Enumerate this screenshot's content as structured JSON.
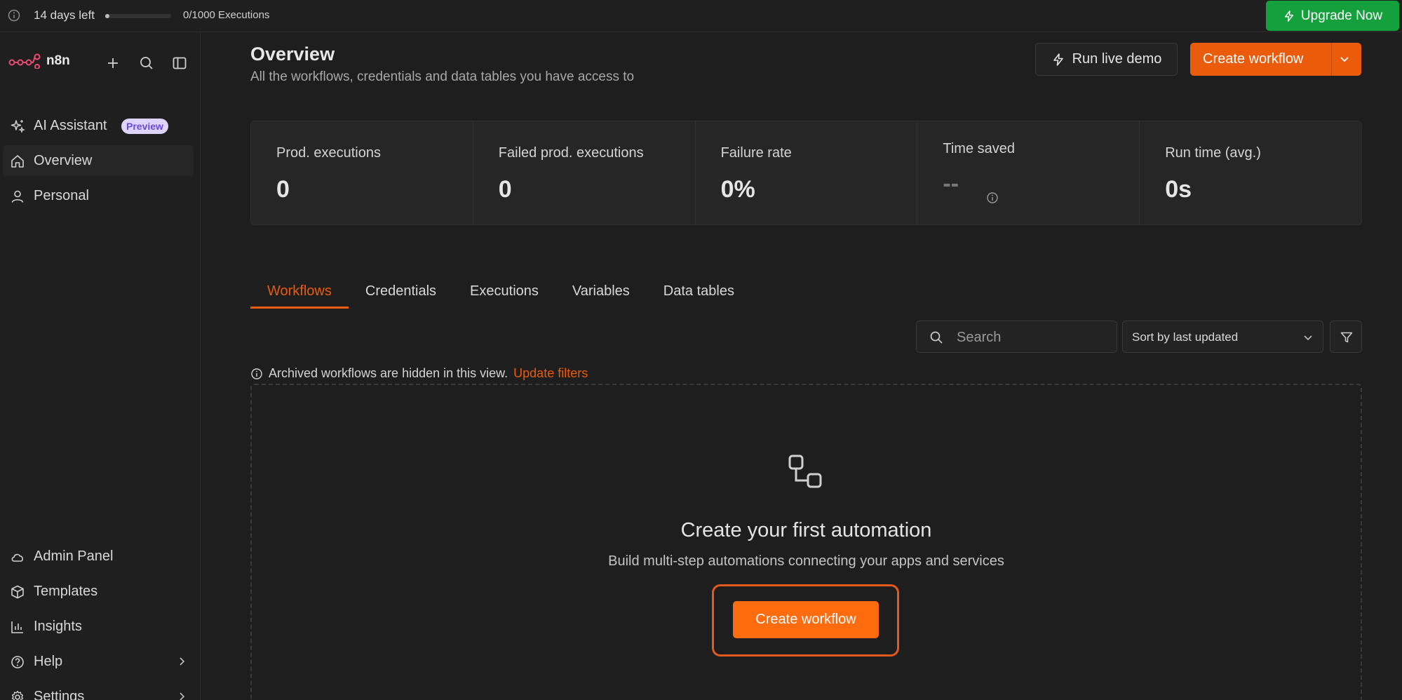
{
  "topbar": {
    "days_left": "14 days left",
    "executions": "0/1000 Executions",
    "upgrade_label": "Upgrade Now"
  },
  "sidebar": {
    "logo_text": "n8n",
    "top_items": [
      {
        "label": "AI Assistant",
        "badge": "Preview",
        "icon": "sparkles-icon"
      },
      {
        "label": "Overview",
        "icon": "home-icon"
      },
      {
        "label": "Personal",
        "icon": "user-icon"
      }
    ],
    "bottom_items": [
      {
        "label": "Admin Panel",
        "icon": "cloud-icon"
      },
      {
        "label": "Templates",
        "icon": "box-icon"
      },
      {
        "label": "Insights",
        "icon": "bar-chart-icon"
      },
      {
        "label": "Help",
        "icon": "help-circle-icon"
      },
      {
        "label": "Settings",
        "icon": "gear-icon"
      }
    ]
  },
  "header": {
    "title": "Overview",
    "subtitle": "All the workflows, credentials and data tables you have access to",
    "run_demo_label": "Run live demo",
    "create_workflow_label": "Create workflow"
  },
  "stats": [
    {
      "label": "Prod. executions",
      "value": "0"
    },
    {
      "label": "Failed prod. executions",
      "value": "0"
    },
    {
      "label": "Failure rate",
      "value": "0%"
    },
    {
      "label": "Time saved",
      "value": "--"
    },
    {
      "label": "Run time (avg.)",
      "value": "0s"
    }
  ],
  "tabs": [
    "Workflows",
    "Credentials",
    "Executions",
    "Variables",
    "Data tables"
  ],
  "toolbar": {
    "search_placeholder": "Search",
    "sort_value": "Sort by last updated"
  },
  "notice": {
    "text": "Archived workflows are hidden in this view.",
    "link": "Update filters"
  },
  "empty_state": {
    "title": "Create your first automation",
    "subtitle": "Build multi-step automations connecting your apps and services",
    "button_label": "Create workflow"
  },
  "colors": {
    "accent": "#ea5b0c",
    "upgrade": "#14a03c",
    "background": "#1e1e1e",
    "badge": "#ddd3fb"
  }
}
